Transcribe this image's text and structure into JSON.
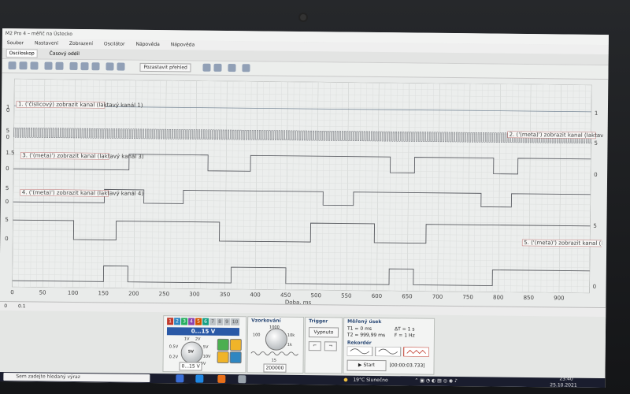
{
  "window": {
    "title": "M2 Pro 4 – měřič na Ústecko"
  },
  "menu": [
    "Soubor",
    "Nastavení",
    "Zobrazení",
    "Oscilátor",
    "Nápověda",
    "Nápověda"
  ],
  "tabs": [
    {
      "label": "Osciloskop",
      "active": true
    },
    {
      "label": "Časový oddíl",
      "active": false
    }
  ],
  "toolbar": {
    "center_label": "Pozastavit přehled"
  },
  "plot": {
    "x_axis_label": "Doba, ms",
    "x_ticks": [
      "0",
      "50",
      "100",
      "150",
      "200",
      "250",
      "300",
      "350",
      "400",
      "450",
      "500",
      "550",
      "600",
      "650",
      "700",
      "750",
      "800",
      "850",
      "900"
    ],
    "left_ticks": [
      "1",
      "0",
      "5",
      "0",
      "1.5",
      "0",
      "5",
      "0",
      "5",
      "0"
    ],
    "right_ticks": [
      "1",
      "5",
      "0",
      "5",
      "0"
    ],
    "channel_labels": [
      "1. ('číslicový) zobrazit kanal (Iaktavý kanál 1)",
      "2. ('(meta)') zobrazit kanal (Iaktavý kanál 2)",
      "3. ('(meta)') zobrazit kanal (Iaktavý kanál 3)",
      "4. ('(meta)') zobrazit kanal (Iaktavý kanál 4)",
      "5. ('(meta)') zobrazit kanal (Iaktavý kanál 5)"
    ]
  },
  "scroll": {
    "left": "0",
    "right": "0.1"
  },
  "channels_panel": {
    "buttons": [
      "1",
      "2",
      "3",
      "4",
      "5",
      "6",
      "7",
      "8",
      "9",
      "10"
    ],
    "range": "0...15 V",
    "knob_labels": [
      "1V",
      "2V",
      "5V",
      "10V",
      "15V",
      "0.5V",
      "0.2V"
    ],
    "knob_value": "5V",
    "bottom_range": "0...15 V"
  },
  "sampling_panel": {
    "title": "Vzorkování",
    "knob_top": "1000",
    "knob_labels": [
      "100",
      "10k",
      "1k"
    ],
    "samples": "15",
    "samples_count": "200000"
  },
  "trigger_panel": {
    "title": "Trigger",
    "mode": "Vypnuto"
  },
  "measure_panel": {
    "title": "Měřený úsek",
    "t1": "T1 = 0 ms",
    "t2": "T2 = 999,99 ms",
    "dt": "ΔT = 1 s",
    "f": "F = 1 Hz",
    "recorder_title": "Rekordér",
    "start": "Start",
    "elapsed": "[00:00:03.733]"
  },
  "taskbar": {
    "search_placeholder": "Sem zadejte hledaný výraz",
    "weather": "19°C Slunečno",
    "time": "23:40",
    "date": "25.10.2021"
  },
  "chart_data": {
    "type": "line",
    "xlabel": "Doba, ms",
    "xlim": [
      0,
      950
    ],
    "series": [
      {
        "values": [
          [
            0,
            1
          ],
          [
            950,
            1
          ]
        ]
      },
      {
        "values": "fast clock ~4 ms period"
      },
      {
        "values": [
          [
            0,
            0
          ],
          [
            190,
            0
          ],
          [
            190,
            1
          ],
          [
            320,
            1
          ],
          [
            320,
            0
          ],
          [
            390,
            0
          ],
          [
            390,
            1
          ],
          [
            620,
            1
          ],
          [
            620,
            0
          ],
          [
            660,
            0
          ],
          [
            660,
            1
          ],
          [
            790,
            1
          ],
          [
            790,
            0
          ],
          [
            830,
            0
          ],
          [
            830,
            1
          ],
          [
            950,
            1
          ]
        ]
      },
      {
        "values": [
          [
            0,
            0
          ],
          [
            150,
            0
          ],
          [
            150,
            1
          ],
          [
            215,
            1
          ],
          [
            215,
            0
          ],
          [
            280,
            0
          ],
          [
            280,
            1
          ],
          [
            510,
            1
          ],
          [
            510,
            0
          ],
          [
            560,
            0
          ],
          [
            560,
            1
          ],
          [
            770,
            1
          ],
          [
            770,
            0
          ],
          [
            820,
            0
          ],
          [
            820,
            1
          ],
          [
            950,
            1
          ]
        ]
      },
      {
        "values": [
          [
            0,
            1
          ],
          [
            100,
            1
          ],
          [
            100,
            0
          ],
          [
            170,
            0
          ],
          [
            170,
            1
          ],
          [
            340,
            1
          ],
          [
            340,
            0
          ],
          [
            490,
            0
          ],
          [
            490,
            1
          ],
          [
            595,
            1
          ],
          [
            595,
            0
          ],
          [
            680,
            0
          ],
          [
            680,
            1
          ],
          [
            950,
            1
          ]
        ]
      },
      {
        "values": [
          [
            0,
            0
          ],
          [
            150,
            0
          ],
          [
            150,
            1
          ],
          [
            190,
            1
          ],
          [
            190,
            0
          ],
          [
            360,
            0
          ],
          [
            360,
            1
          ],
          [
            450,
            1
          ],
          [
            450,
            0
          ],
          [
            620,
            0
          ],
          [
            620,
            1
          ],
          [
            660,
            1
          ],
          [
            660,
            0
          ],
          [
            790,
            0
          ],
          [
            790,
            1
          ],
          [
            950,
            1
          ]
        ]
      }
    ]
  }
}
